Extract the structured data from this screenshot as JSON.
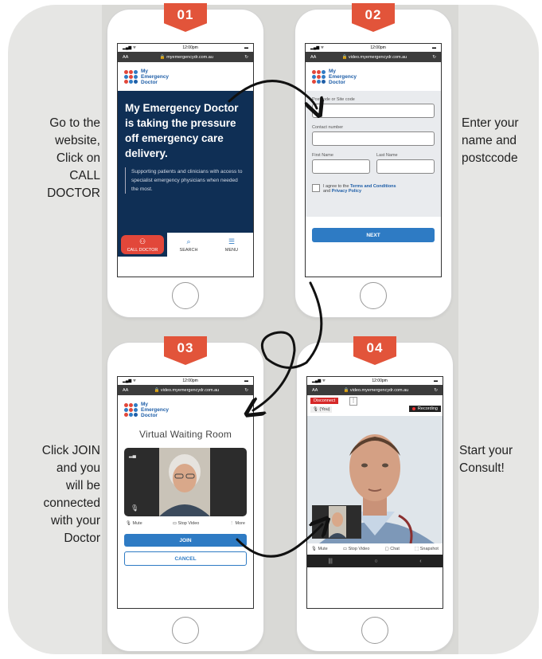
{
  "steps": [
    {
      "number": "01",
      "caption_lines": [
        "Go to the",
        "website,",
        "Click on",
        "CALL",
        "DOCTOR"
      ],
      "status_time": "12:00pm",
      "aa": "AA",
      "url": "myemergencydr.com.au",
      "logo_lines": [
        "My",
        "Emergency",
        "Doctor"
      ],
      "hero_title": "My Emergency Doctor is taking the pressure off emergency care delivery.",
      "hero_sub": "Supporting patients and clinicians with access to specialist emergency physicians when needed the most.",
      "nav": {
        "call": "CALL DOCTOR",
        "search": "SEARCH",
        "menu": "MENU"
      }
    },
    {
      "number": "02",
      "caption_lines": [
        "Enter your",
        "name and",
        "postccode"
      ],
      "status_time": "12:00pm",
      "aa": "AA",
      "url": "video.myemergencydr.com.au",
      "logo_lines": [
        "My",
        "Emergency",
        "Doctor"
      ],
      "form": {
        "postcode_label": "Postcode or Site code",
        "contact_label": "Contact number",
        "first_label": "First Name",
        "last_label": "Last Name",
        "agree_prefix": "I agree to the",
        "terms": "Terms and Conditions",
        "and": "and",
        "privacy": "Privacy Policy",
        "next": "NEXT"
      }
    },
    {
      "number": "03",
      "caption_lines": [
        "Click JOIN",
        "and you",
        "will be",
        "connected",
        "with your",
        "Doctor"
      ],
      "status_time": "12:00pm",
      "aa": "AA",
      "url": "video.myemergencydr.com.au",
      "logo_lines": [
        "My",
        "Emergency",
        "Doctor"
      ],
      "room_title": "Virtual Waiting Room",
      "controls": {
        "mute": "Mute",
        "stop": "Stop Video",
        "more": "More"
      },
      "join": "JOIN",
      "cancel": "CANCEL"
    },
    {
      "number": "04",
      "caption_lines": [
        "Start your",
        "Consult!"
      ],
      "status_time": "12:00pm",
      "aa": "AA",
      "url": "video.myemergencydr.com.au",
      "disconnect": "Disconnect",
      "you": "(You)",
      "recording": "Recording",
      "controls": {
        "mute": "Mute",
        "stop": "Stop Video",
        "chat": "Chat",
        "snapshot": "Snapshot"
      }
    }
  ],
  "colors": {
    "badge": "#e2543a",
    "navy": "#0f2f55",
    "brand_blue": "#2e7bc4",
    "call_red": "#e2473a",
    "logo_dots": [
      "#e2473a",
      "#2e7bc4",
      "#1f5fa8"
    ]
  },
  "icons": [
    "lock-icon",
    "reload-icon",
    "person-icon",
    "search-icon",
    "menu-icon",
    "mic-icon",
    "camera-icon",
    "more-icon",
    "chat-icon",
    "snapshot-icon",
    "signal-icon",
    "wifi-icon",
    "battery-icon",
    "arrow-icon"
  ]
}
